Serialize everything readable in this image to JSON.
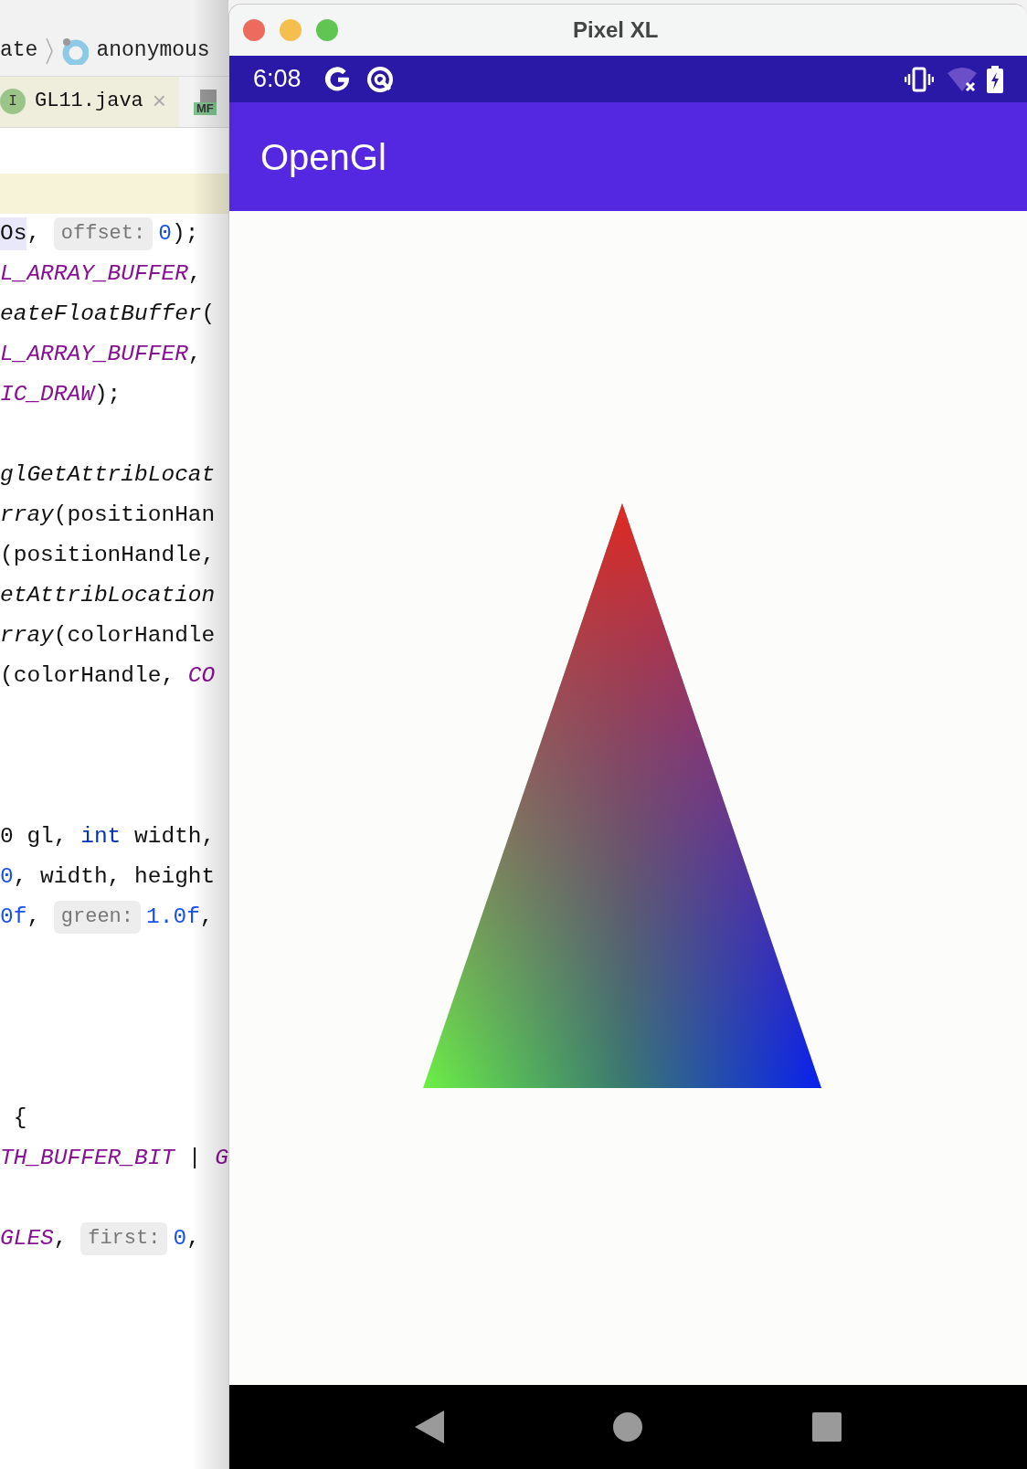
{
  "ide": {
    "breadcrumb": [
      {
        "kind": "text",
        "text": "ate"
      },
      {
        "kind": "class",
        "text": "anonymous"
      }
    ],
    "tabs": [
      {
        "kind": "class",
        "badge": "I",
        "label": "GL11.java",
        "close": "×",
        "selected": true
      },
      {
        "kind": "manifest",
        "badge": "MF",
        "selected": false
      }
    ],
    "code": [
      {
        "current": false
      },
      {
        "current": true
      },
      {
        "current": false,
        "tokens": [
          {
            "kind": "selected",
            "text": "Os"
          },
          {
            "kind": "plain",
            "text": ", "
          },
          {
            "kind": "hint",
            "text": "offset:"
          },
          {
            "kind": "num",
            "text": "0"
          },
          {
            "kind": "plain",
            "text": ");"
          }
        ]
      },
      {
        "current": false,
        "tokens": [
          {
            "kind": "const",
            "text": "L_ARRAY_BUFFER"
          },
          {
            "kind": "plain",
            "text": ","
          }
        ]
      },
      {
        "current": false,
        "tokens": [
          {
            "kind": "static",
            "text": "eateFloatBuffer"
          },
          {
            "kind": "plain",
            "text": "("
          }
        ]
      },
      {
        "current": false,
        "tokens": [
          {
            "kind": "const",
            "text": "L_ARRAY_BUFFER"
          },
          {
            "kind": "plain",
            "text": ","
          }
        ]
      },
      {
        "current": false,
        "tokens": [
          {
            "kind": "const",
            "text": "IC_DRAW"
          },
          {
            "kind": "plain",
            "text": ");"
          }
        ]
      },
      {
        "current": false
      },
      {
        "current": false,
        "tokens": [
          {
            "kind": "static",
            "text": "glGetAttribLocat"
          }
        ]
      },
      {
        "current": false,
        "tokens": [
          {
            "kind": "static",
            "text": "rray"
          },
          {
            "kind": "plain",
            "text": "(positionHan"
          }
        ]
      },
      {
        "current": false,
        "tokens": [
          {
            "kind": "plain",
            "text": "(positionHandle,"
          }
        ]
      },
      {
        "current": false,
        "tokens": [
          {
            "kind": "static",
            "text": "etAttribLocation"
          }
        ]
      },
      {
        "current": false,
        "tokens": [
          {
            "kind": "static",
            "text": "rray"
          },
          {
            "kind": "plain",
            "text": "(colorHandle"
          }
        ]
      },
      {
        "current": false,
        "tokens": [
          {
            "kind": "plain",
            "text": "(colorHandle, "
          },
          {
            "kind": "const",
            "text": "CO"
          }
        ]
      },
      {
        "current": false
      },
      {
        "current": false
      },
      {
        "current": false
      },
      {
        "current": false,
        "tokens": [
          {
            "kind": "plain",
            "text": "0 gl, "
          },
          {
            "kind": "keyword",
            "text": "int"
          },
          {
            "kind": "plain",
            "text": " width,"
          }
        ]
      },
      {
        "current": false,
        "tokens": [
          {
            "kind": "num",
            "text": "0"
          },
          {
            "kind": "plain",
            "text": ", width, height"
          }
        ]
      },
      {
        "current": false,
        "tokens": [
          {
            "kind": "num",
            "text": "0f"
          },
          {
            "kind": "plain",
            "text": ", "
          },
          {
            "kind": "hint",
            "text": "green:"
          },
          {
            "kind": "num",
            "text": "1.0f"
          },
          {
            "kind": "plain",
            "text": ","
          }
        ]
      },
      {
        "current": false
      },
      {
        "current": false
      },
      {
        "current": false
      },
      {
        "current": false
      },
      {
        "current": false,
        "tokens": [
          {
            "kind": "plain",
            "text": " {"
          }
        ]
      },
      {
        "current": false,
        "tokens": [
          {
            "kind": "const",
            "text": "TH_BUFFER_BIT"
          },
          {
            "kind": "plain",
            "text": " | "
          },
          {
            "kind": "const",
            "text": "G"
          }
        ]
      },
      {
        "current": false
      },
      {
        "current": false,
        "tokens": [
          {
            "kind": "const",
            "text": "GLES"
          },
          {
            "kind": "plain",
            "text": ", "
          },
          {
            "kind": "hint",
            "text": "first:"
          },
          {
            "kind": "num",
            "text": "0"
          },
          {
            "kind": "plain",
            "text": ","
          }
        ]
      }
    ]
  },
  "emulator": {
    "title": "Pixel XL",
    "status_bar": {
      "time": "6:08"
    },
    "app_bar": {
      "title": "OpenGl"
    }
  }
}
